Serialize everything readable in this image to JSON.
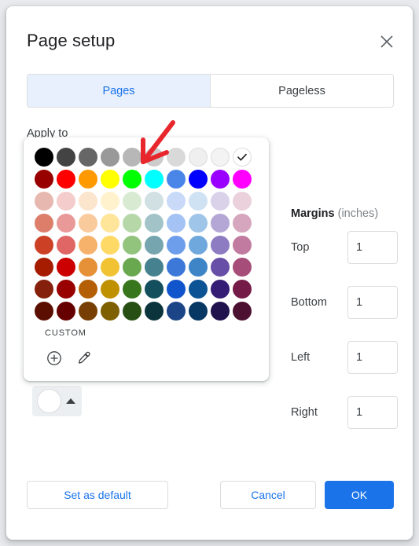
{
  "dialog": {
    "title": "Page setup",
    "close_icon": "close-icon"
  },
  "tabs": [
    {
      "label": "Pages",
      "active": true
    },
    {
      "label": "Pageless",
      "active": false
    }
  ],
  "apply_to": {
    "label": "Apply to"
  },
  "page_color": {
    "selected_color": "#ffffff",
    "caret_icon": "caret-up-icon"
  },
  "color_popup": {
    "custom_label": "CUSTOM",
    "add_icon": "plus-circle-icon",
    "eyedropper_icon": "eyedropper-icon",
    "selected_index": 9,
    "rows": [
      [
        "#000000",
        "#434343",
        "#666666",
        "#999999",
        "#b7b7b7",
        "#cccccc",
        "#d9d9d9",
        "#efefef",
        "#f3f3f3",
        "#ffffff"
      ],
      [
        "#980000",
        "#ff0000",
        "#ff9900",
        "#ffff00",
        "#00ff00",
        "#00ffff",
        "#4a86e8",
        "#0000ff",
        "#9900ff",
        "#ff00ff"
      ],
      [
        "#e6b8af",
        "#f4cccc",
        "#fce5cd",
        "#fff2cc",
        "#d9ead3",
        "#d0e0e3",
        "#c9daf8",
        "#cfe2f3",
        "#d9d2e9",
        "#ead1dc"
      ],
      [
        "#dd7e6b",
        "#ea9999",
        "#f9cb9c",
        "#ffe599",
        "#b6d7a8",
        "#a2c4c9",
        "#a4c2f4",
        "#9fc5e8",
        "#b4a7d6",
        "#d5a6bd"
      ],
      [
        "#cc4125",
        "#e06666",
        "#f6b26b",
        "#ffd966",
        "#93c47d",
        "#76a5af",
        "#6d9eeb",
        "#6fa8dc",
        "#8e7cc3",
        "#c27ba0"
      ],
      [
        "#a61c00",
        "#cc0000",
        "#e69138",
        "#f1c232",
        "#6aa84f",
        "#45818e",
        "#3c78d8",
        "#3d85c6",
        "#674ea7",
        "#a64d79"
      ],
      [
        "#85200c",
        "#990000",
        "#b45f06",
        "#bf9000",
        "#38761d",
        "#134f5c",
        "#1155cc",
        "#0b5394",
        "#351c75",
        "#741b47"
      ],
      [
        "#5b0f00",
        "#660000",
        "#783f04",
        "#7f6000",
        "#274e13",
        "#0c343d",
        "#1c4587",
        "#073763",
        "#20124d",
        "#4c1130"
      ]
    ]
  },
  "margins": {
    "title": "Margins",
    "unit": "(inches)",
    "fields": [
      {
        "label": "Top",
        "value": "1"
      },
      {
        "label": "Bottom",
        "value": "1"
      },
      {
        "label": "Left",
        "value": "1"
      },
      {
        "label": "Right",
        "value": "1"
      }
    ]
  },
  "footer": {
    "set_default_label": "Set as default",
    "cancel_label": "Cancel",
    "ok_label": "OK"
  },
  "annotation": {
    "arrow_color": "#e8272c"
  }
}
